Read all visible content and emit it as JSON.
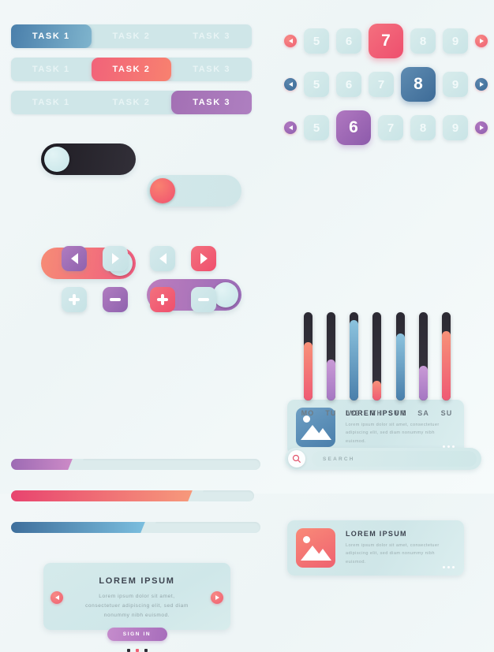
{
  "theme": {
    "background": "#f2f7f8",
    "accent_red": "#ef5f72",
    "accent_blue": "#4a7fab",
    "accent_purple": "#9a6cb8",
    "light_mint": "#cfe6e8",
    "dark": "#2c2a33"
  },
  "task_bars": [
    {
      "active_index": 0,
      "color": "blue",
      "segments": [
        "TASK 1",
        "TASK 2",
        "TASK 3"
      ]
    },
    {
      "active_index": 1,
      "color": "red",
      "segments": [
        "TASK 1",
        "TASK 2",
        "TASK 3"
      ]
    },
    {
      "active_index": 2,
      "color": "purple",
      "segments": [
        "TASK 1",
        "TASK 2",
        "TASK 3"
      ]
    }
  ],
  "toggles": [
    {
      "name": "toggle-dark-off",
      "state": "off",
      "track": "dark",
      "knob": "mint"
    },
    {
      "name": "toggle-light-off",
      "state": "off",
      "track": "light",
      "knob": "red"
    },
    {
      "name": "toggle-red-on",
      "state": "on",
      "track": "red",
      "knob": "mint"
    },
    {
      "name": "toggle-purple-on",
      "state": "on",
      "track": "purple",
      "knob": "mint"
    }
  ],
  "arrow_buttons": [
    {
      "name": "prev-button-purple",
      "icon": "caret-left-icon",
      "style": "purple"
    },
    {
      "name": "next-button-light",
      "icon": "caret-right-icon",
      "style": "light"
    },
    {
      "name": "prev-button-light",
      "icon": "caret-left-icon",
      "style": "light"
    },
    {
      "name": "next-button-red",
      "icon": "caret-right-icon",
      "style": "red"
    }
  ],
  "stepper_buttons": [
    {
      "name": "increment-button-light",
      "icon": "plus-icon",
      "style": "light"
    },
    {
      "name": "decrement-button-purple",
      "icon": "minus-icon",
      "style": "purple"
    },
    {
      "name": "increment-button-red",
      "icon": "plus-icon",
      "style": "red"
    },
    {
      "name": "decrement-button-light",
      "icon": "minus-icon",
      "style": "light"
    }
  ],
  "progress_bars": [
    {
      "name": "progress-purple",
      "color": "purple",
      "percent": 26
    },
    {
      "name": "progress-red",
      "color": "red",
      "percent": 76
    },
    {
      "name": "progress-blue",
      "color": "blue",
      "percent": 55
    }
  ],
  "lorem_card": {
    "title": "LOREM IPSUM",
    "body": "Lorem ipsum dolor sit amet, consectetuer adipiscing elit, sed diam nonummy nibh euismod.",
    "button_label": "SIGN IN",
    "prev_icon": "caret-left-icon",
    "next_icon": "caret-right-icon",
    "dots": [
      {
        "active": false
      },
      {
        "active": true
      },
      {
        "active": false
      }
    ]
  },
  "pagination": [
    {
      "name": "pagination-red",
      "color": "red",
      "prev_icon": "caret-left-icon",
      "next_icon": "caret-right-icon",
      "pages": [
        "5",
        "6",
        "7",
        "8",
        "9"
      ],
      "active": "7"
    },
    {
      "name": "pagination-blue",
      "color": "blue",
      "prev_icon": "caret-left-icon",
      "next_icon": "caret-right-icon",
      "pages": [
        "5",
        "6",
        "7",
        "8",
        "9"
      ],
      "active": "8"
    },
    {
      "name": "pagination-purple",
      "color": "purple",
      "prev_icon": "caret-left-icon",
      "next_icon": "caret-right-icon",
      "pages": [
        "5",
        "6",
        "7",
        "8",
        "9"
      ],
      "active": "6"
    }
  ],
  "media_cards": [
    {
      "name": "media-card-blue",
      "thumb_color": "blue",
      "thumb_icon": "image-placeholder-icon",
      "title": "LOREM IPSUM",
      "body": "Lorem ipsum dolor sit amet, consectetuer adipiscing elit, sed diam nonummy nibh euismod.",
      "menu_icon": "more-dots-icon"
    },
    {
      "name": "media-card-red",
      "thumb_color": "red",
      "thumb_icon": "image-placeholder-icon",
      "title": "LOREM IPSUM",
      "body": "Lorem ipsum dolor sit amet, consectetuer adipiscing elit, sed diam nonummy nibh euismod.",
      "menu_icon": "more-dots-icon"
    }
  ],
  "chart_data": {
    "type": "bar",
    "title": "",
    "xlabel": "",
    "ylabel": "",
    "ylim": [
      0,
      100
    ],
    "grid": false,
    "legend": "none",
    "orientation": "vertical",
    "categories": [
      "MO",
      "TU",
      "WE",
      "TH",
      "FR",
      "SA",
      "SU"
    ],
    "values": [
      66,
      46,
      91,
      22,
      76,
      39,
      79
    ],
    "colors": [
      "red",
      "purple",
      "blue",
      "red",
      "blue",
      "purple",
      "red"
    ],
    "track_color": "#2c2a33"
  },
  "search": {
    "name": "search-bar",
    "icon": "search-icon",
    "placeholder": "SEARCH",
    "value": ""
  }
}
